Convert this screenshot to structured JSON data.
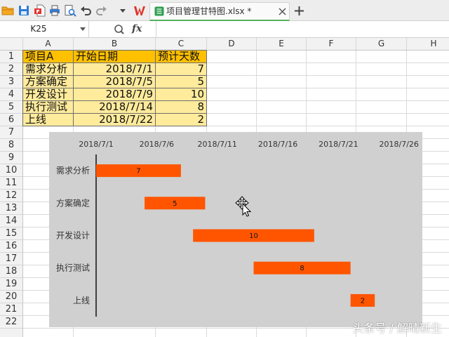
{
  "toolbar": {
    "quick_access_icons": [
      "open-folder-icon",
      "save-icon",
      "export-pdf-icon",
      "print-icon",
      "print-preview-icon",
      "undo-icon",
      "redo-icon",
      "customize-dropdown-icon",
      "wps-logo-icon"
    ],
    "tab_title": "项目管理甘特图.xlsx *"
  },
  "formula_bar": {
    "name_box": "K25",
    "fx_label": "fx"
  },
  "grid": {
    "columns": [
      "A",
      "B",
      "C",
      "D",
      "E",
      "F",
      "G",
      "H"
    ],
    "row_numbers": [
      "1",
      "2",
      "3",
      "4",
      "5",
      "6",
      "7",
      "8",
      "9",
      "10",
      "11",
      "12",
      "13",
      "14",
      "15",
      "16",
      "17",
      "18",
      "19",
      "20",
      "21",
      "22"
    ]
  },
  "table": {
    "header": [
      "项目A",
      "开始日期",
      "预计天数"
    ],
    "rows": [
      [
        "需求分析",
        "2018/7/1",
        "7"
      ],
      [
        "方案确定",
        "2018/7/5",
        "5"
      ],
      [
        "开发设计",
        "2018/7/9",
        "10"
      ],
      [
        "执行测试",
        "2018/7/14",
        "8"
      ],
      [
        "上线",
        "2018/7/22",
        "2"
      ]
    ]
  },
  "chart_data": {
    "type": "bar",
    "orientation": "horizontal",
    "categories": [
      "需求分析",
      "方案确定",
      "开发设计",
      "执行测试",
      "上线"
    ],
    "start": [
      "2018/7/1",
      "2018/7/5",
      "2018/7/9",
      "2018/7/14",
      "2018/7/22"
    ],
    "values": [
      7,
      5,
      10,
      8,
      2
    ],
    "x_ticks": [
      "2018/7/1",
      "2018/7/6",
      "2018/7/11",
      "2018/7/16",
      "2018/7/21",
      "2018/7/26"
    ],
    "xlim": [
      "2018/7/1",
      "2018/7/27"
    ],
    "x_axis_position": "top",
    "data_labels": true,
    "grid": false,
    "legend": "none"
  },
  "watermark": "头条号 / 解晴新生",
  "colors": {
    "header_fill": "#FFC000",
    "body_fill": "#FFEB9C",
    "bar": "#FF5500",
    "chart_background": "#D0D0D0",
    "tab_accent": "#55B05A"
  }
}
